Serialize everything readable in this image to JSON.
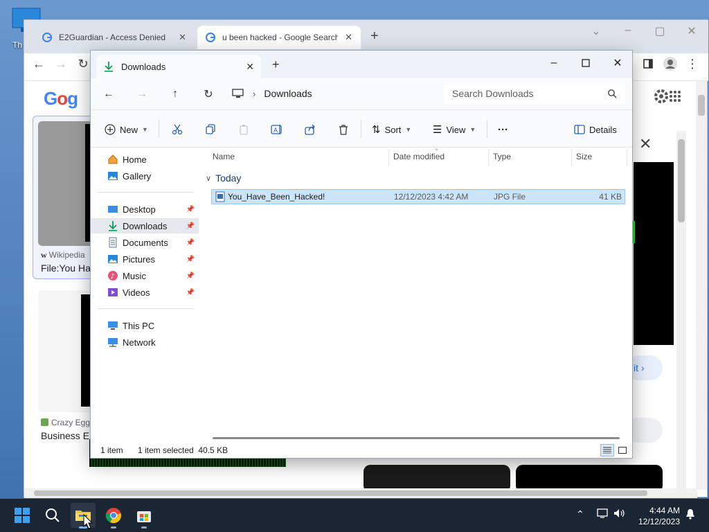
{
  "desktop": {
    "icon_label": "Th"
  },
  "chrome": {
    "tabs": [
      {
        "title": "E2Guardian - Access Denied",
        "close": "✕"
      },
      {
        "title": "u been hacked - Google Search",
        "close": "✕"
      }
    ],
    "new_tab": "+"
  },
  "google": {
    "result1_source": "Wikipedia",
    "result1_title": "File:You Ha",
    "result2_source": "Crazy Egg",
    "result2_title": "Business E",
    "visit_label": "it ›"
  },
  "explorer": {
    "tab_title": "Downloads",
    "tab_close": "✕",
    "new_tab": "+",
    "breadcrumb": "Downloads",
    "search_placeholder": "Search Downloads",
    "commands": {
      "new": "New",
      "sort": "Sort",
      "view": "View",
      "more": "···",
      "details": "Details"
    },
    "nav": {
      "home": "Home",
      "gallery": "Gallery",
      "desktop": "Desktop",
      "downloads": "Downloads",
      "documents": "Documents",
      "pictures": "Pictures",
      "music": "Music",
      "videos": "Videos",
      "this_pc": "This PC",
      "network": "Network"
    },
    "columns": {
      "name": "Name",
      "date": "Date modified",
      "type": "Type",
      "size": "Size"
    },
    "group": "Today",
    "files": [
      {
        "name": "You_Have_Been_Hacked!",
        "date": "12/12/2023 4:42 AM",
        "type": "JPG File",
        "size": "41 KB"
      }
    ],
    "status": {
      "count": "1 item",
      "selected": "1 item selected  40.5 KB"
    }
  },
  "taskbar": {
    "time": "4:44 AM",
    "date": "12/12/2023"
  }
}
